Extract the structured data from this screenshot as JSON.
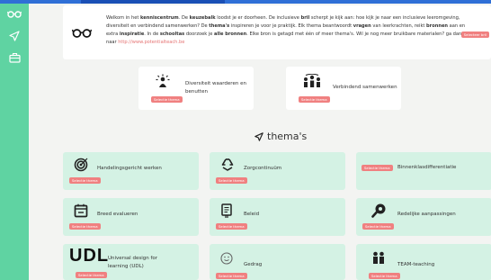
{
  "sidebar": {
    "items": [
      {
        "icon": "glasses-icon"
      },
      {
        "icon": "send-icon"
      },
      {
        "icon": "briefcase-icon"
      }
    ]
  },
  "intro": {
    "icon": "glasses-icon",
    "t1": "Welkom in het ",
    "b1": "kenniscentrum",
    "t2": ". De ",
    "b2": "keuzebalk",
    "t3": " loodst je er doorheen. De inclusieve ",
    "b3": "bril",
    "t4": " scherpt je kijk aan: hoe kijk je naar een inclusieve leeromgeving, diversiteit en verbindend samenwerken? De ",
    "b4": "thema's",
    "t5": " inspireren je voor je praktijk. Elk thema beantwoordt ",
    "b5": "vragen",
    "t6": " van leerkrachten, reikt ",
    "b6": "bronnen",
    "t7": " aan en extra ",
    "b7": "inspiratie",
    "t8": ". In de ",
    "b8": "schooltas",
    "t9": " doorzoek je ",
    "b9": "alle bronnen",
    "t10": ". Elke bron is getagd met één of meer thema's. Wil je nog meer bruikbare materialen? ga dan naar ",
    "link": "http://www.potentialteach.be",
    "button": "Selecteer bril"
  },
  "featured": [
    {
      "title": "Diversiteit waarderen en benutten",
      "button": "Selectie thema",
      "icon": "people-diversity-icon"
    },
    {
      "title": "Verbindend samenwerken",
      "button": "Selectie thema",
      "icon": "team-connect-icon"
    }
  ],
  "section": {
    "title": "thema's",
    "icon": "send-icon"
  },
  "themes": [
    {
      "title": "Handelingsgericht werken",
      "button": "Selectie thema",
      "icon": "target-icon"
    },
    {
      "title": "Zorgcontinuüm",
      "button": "Selectie thema",
      "icon": "recycle-icon"
    },
    {
      "title": "Binnenklasdifferentiatie",
      "button": "Selectie thema",
      "icon": ""
    },
    {
      "title": "Breed evalueren",
      "button": "Selectie thema",
      "icon": "calendar-icon"
    },
    {
      "title": "Beleid",
      "button": "Selectie thema",
      "icon": "document-icon"
    },
    {
      "title": "Redelijke aanpassingen",
      "button": "Selectie thema",
      "icon": "wrench-icon"
    },
    {
      "title": "Universal design for learning (UDL)",
      "button": "Selectie thema",
      "icon": "udl-logo",
      "logo_text": "UDL"
    },
    {
      "title": "Gedrag",
      "button": "Selectie thema",
      "icon": "smiley-icon"
    },
    {
      "title": "TEAM-teaching",
      "button": "Selectie thema",
      "icon": "team-icon"
    }
  ],
  "colors": {
    "sidebar": "#5fd3a2",
    "card": "#d4f2e4",
    "button": "#f08080",
    "topbar": "#2f6fd6"
  }
}
